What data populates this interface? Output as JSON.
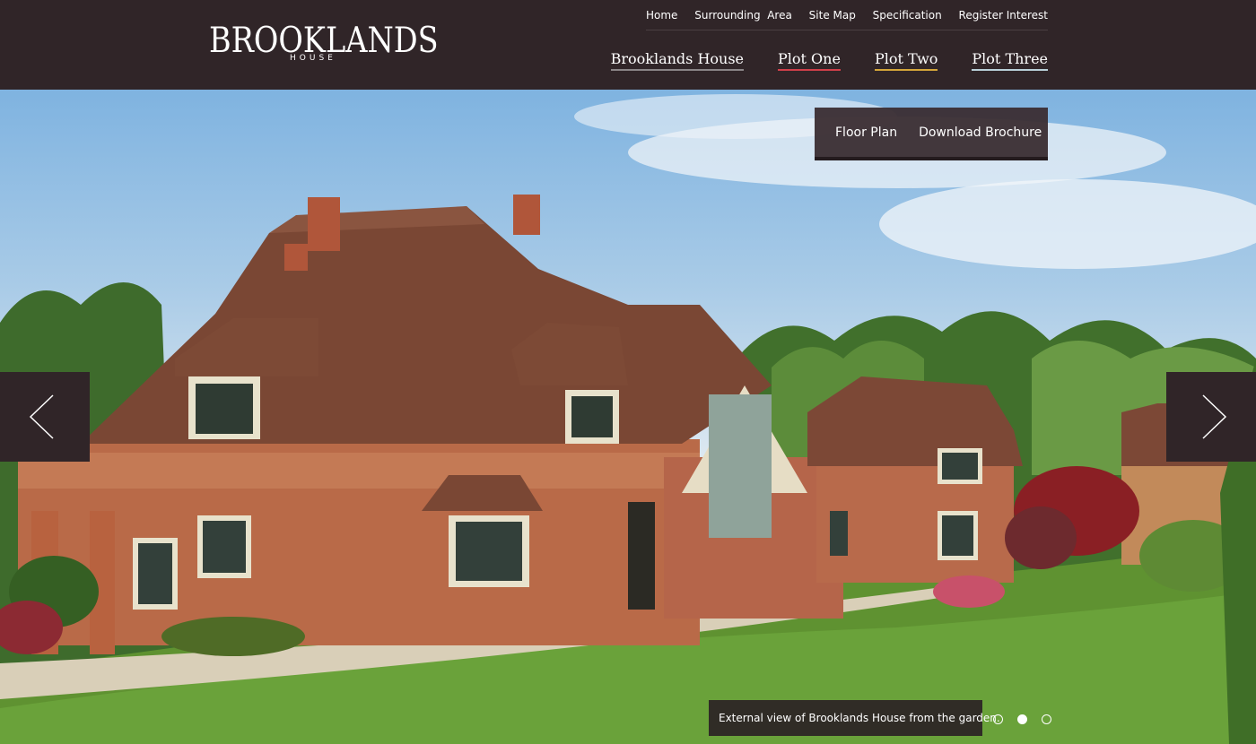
{
  "brand": {
    "name": "BROOKLANDS",
    "sub": "HOUSE"
  },
  "utility_nav": [
    {
      "label": "Home"
    },
    {
      "label": "Surrounding  Area"
    },
    {
      "label": "Site Map"
    },
    {
      "label": "Specification"
    },
    {
      "label": "Register Interest"
    }
  ],
  "main_nav": [
    {
      "label": "Brooklands House",
      "color": "#8a8587"
    },
    {
      "label": "Plot One",
      "color": "#d0404a"
    },
    {
      "label": "Plot Two",
      "color": "#d4a63a"
    },
    {
      "label": "Plot Three",
      "color": "#b9d0d8"
    }
  ],
  "actions": {
    "floor_plan": "Floor Plan",
    "brochure": "Download Brochure"
  },
  "slider": {
    "caption": "External view of Brooklands House from the garden.",
    "slide_count": 3,
    "active_slide": 2,
    "prev_icon": "chevron-left-icon",
    "next_icon": "chevron-right-icon"
  },
  "colors": {
    "header_bg": "#302528",
    "panel_bg": "#3a2d32"
  }
}
